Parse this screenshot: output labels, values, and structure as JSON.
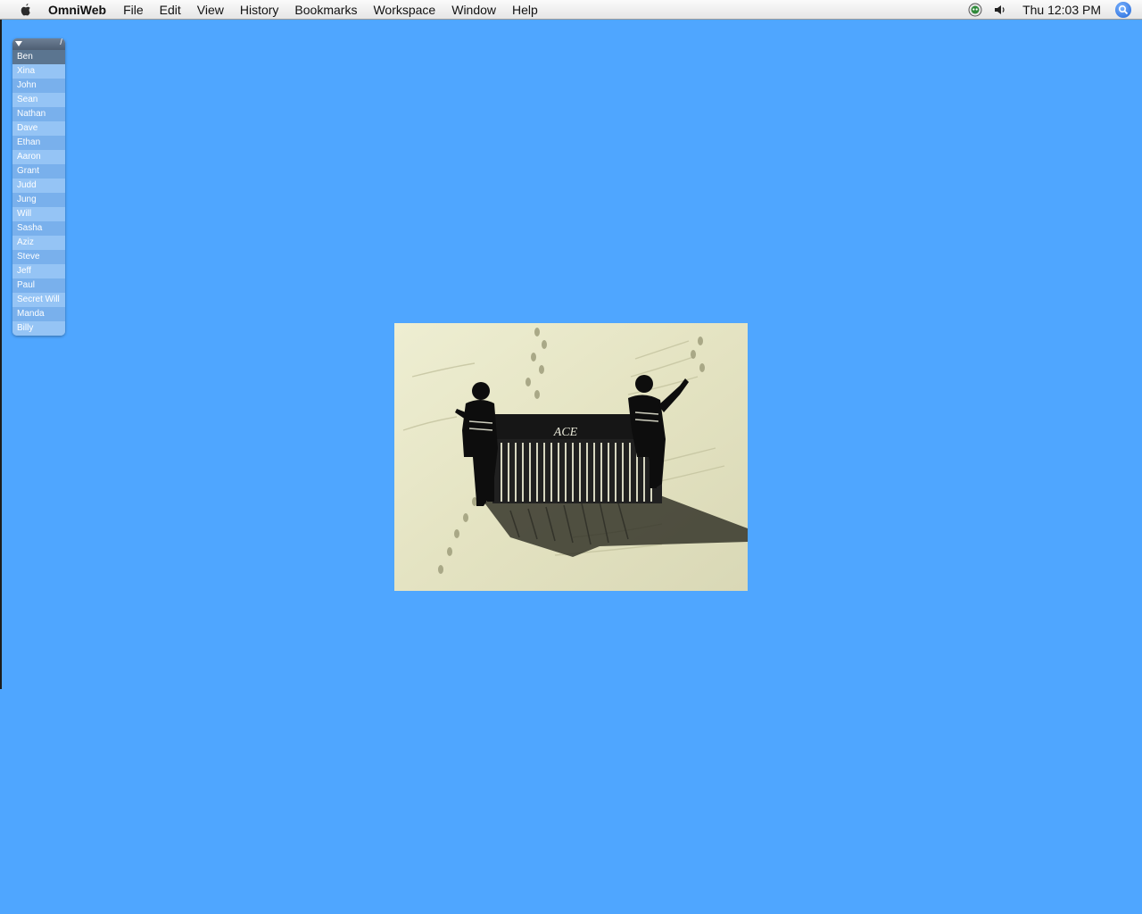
{
  "menubar": {
    "apple_icon": "apple-logo-icon",
    "app_name": "OmniWeb",
    "items": [
      "File",
      "Edit",
      "View",
      "History",
      "Bookmarks",
      "Workspace",
      "Window",
      "Help"
    ],
    "status_icons": [
      "chat-status-icon",
      "volume-icon"
    ],
    "clock": "Thu 12:03 PM",
    "spotlight_icon": "spotlight-search-icon"
  },
  "drawer": {
    "toggle_icon": "disclosure-triangle-icon",
    "slash": "/",
    "items": [
      "Ben",
      "Xina",
      "John",
      "Sean",
      "Nathan",
      "Dave",
      "Ethan",
      "Aaron",
      "Grant",
      "Judd",
      "Jung",
      "Will",
      "Sasha",
      "Aziz",
      "Steve",
      "Jeff",
      "Paul",
      "Secret Will",
      "Manda",
      "Billy"
    ],
    "selected_index": 0
  },
  "photo": {
    "sign_text": "ACE"
  },
  "colors": {
    "desktop_background": "#4fa6ff",
    "drawer_selected": "#5b7590"
  }
}
